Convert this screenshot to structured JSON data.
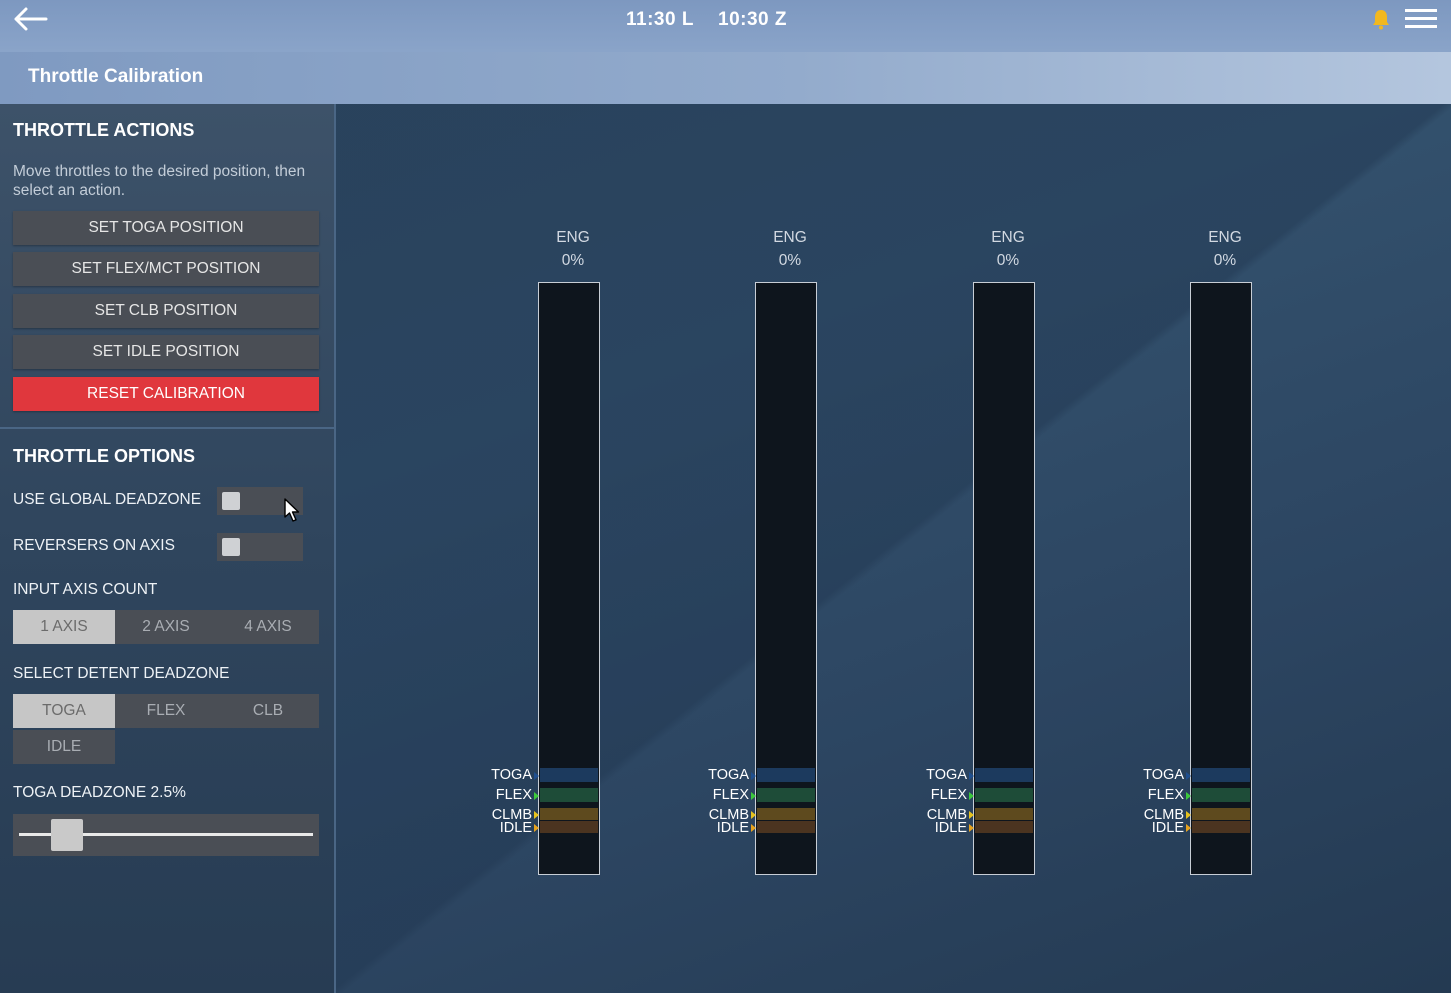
{
  "header": {
    "time_local": "11:30 L",
    "time_zulu": "10:30 Z",
    "title": "Throttle Calibration"
  },
  "actions": {
    "heading": "THROTTLE ACTIONS",
    "help": "Move throttles to the desired position, then select an action.",
    "buttons": [
      {
        "label": "SET TOGA POSITION"
      },
      {
        "label": "SET FLEX/MCT POSITION"
      },
      {
        "label": "SET CLB POSITION"
      },
      {
        "label": "SET IDLE POSITION"
      },
      {
        "label": "RESET CALIBRATION"
      }
    ]
  },
  "options": {
    "heading": "THROTTLE OPTIONS",
    "global_deadzone": {
      "label": "USE GLOBAL DEADZONE",
      "on": false
    },
    "reversers": {
      "label": "REVERSERS ON AXIS",
      "on": false
    },
    "axis_count": {
      "label": "INPUT AXIS COUNT",
      "options": [
        "1 AXIS",
        "2 AXIS",
        "4 AXIS"
      ],
      "selected": "1 AXIS"
    },
    "detent": {
      "label": "SELECT DETENT DEADZONE",
      "options": [
        "TOGA",
        "FLEX",
        "CLB",
        "IDLE"
      ],
      "selected": "TOGA"
    },
    "deadzone_label": "TOGA DEADZONE 2.5%",
    "deadzone_percent": 2.5
  },
  "engines": [
    {
      "label": "ENG",
      "value": "0%"
    },
    {
      "label": "ENG",
      "value": "0%"
    },
    {
      "label": "ENG",
      "value": "0%"
    },
    {
      "label": "ENG",
      "value": "0%"
    }
  ],
  "detents": [
    {
      "label": "TOGA",
      "color": "#1f4f8f"
    },
    {
      "label": "FLEX",
      "color": "#3cc83c"
    },
    {
      "label": "CLMB",
      "color": "#e6c21e"
    },
    {
      "label": "IDLE",
      "color": "#e6a21e"
    }
  ],
  "colors": {
    "danger": "#e0373d",
    "bell": "#f2b81f"
  }
}
